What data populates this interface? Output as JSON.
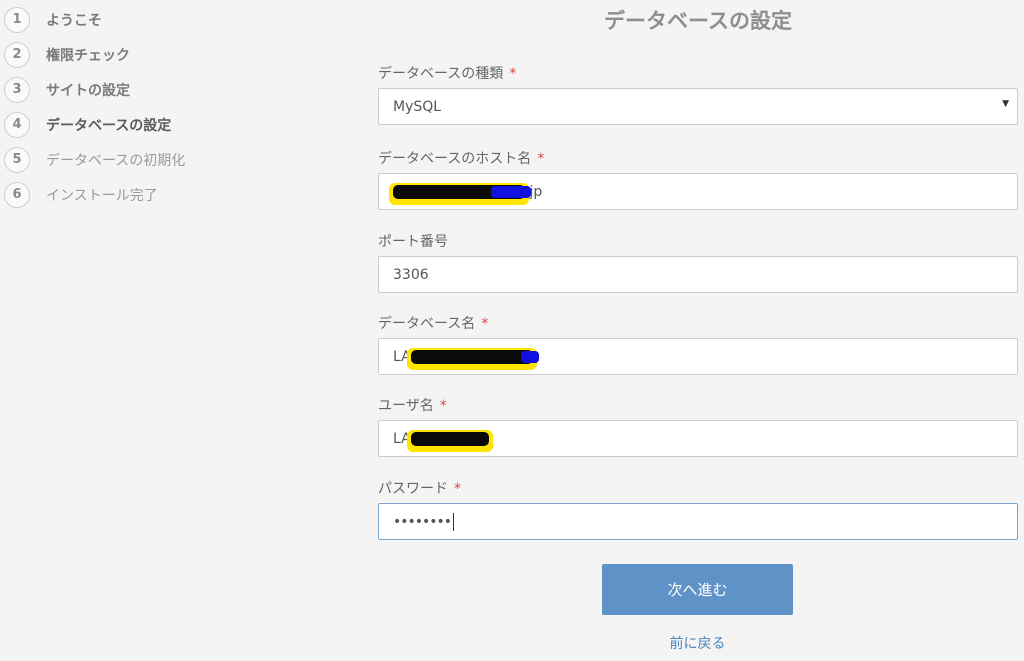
{
  "steps": [
    {
      "num": "1",
      "label": "ようこそ",
      "state": "done"
    },
    {
      "num": "2",
      "label": "権限チェック",
      "state": "done"
    },
    {
      "num": "3",
      "label": "サイトの設定",
      "state": "done"
    },
    {
      "num": "4",
      "label": "データベースの設定",
      "state": "current"
    },
    {
      "num": "5",
      "label": "データベースの初期化",
      "state": "todo"
    },
    {
      "num": "6",
      "label": "インストール完了",
      "state": "todo"
    }
  ],
  "page_title": "データベースの設定",
  "required_mark": "*",
  "form": {
    "db_type": {
      "label": "データベースの種類",
      "value": "MySQL"
    },
    "db_host": {
      "label": "データベースのホスト名",
      "value_suffix": ".jp"
    },
    "port": {
      "label": "ポート番号",
      "value": "3306"
    },
    "db_name": {
      "label": "データベース名",
      "value_prefix": "LA"
    },
    "user": {
      "label": "ユーザ名",
      "value_prefix": "LA"
    },
    "password": {
      "label": "パスワード",
      "value": "••••••••"
    }
  },
  "buttons": {
    "next": "次へ進む",
    "back": "前に戻る"
  },
  "colors": {
    "primary": "#5f93c8",
    "required": "#d44444",
    "link": "#4c87c1"
  }
}
